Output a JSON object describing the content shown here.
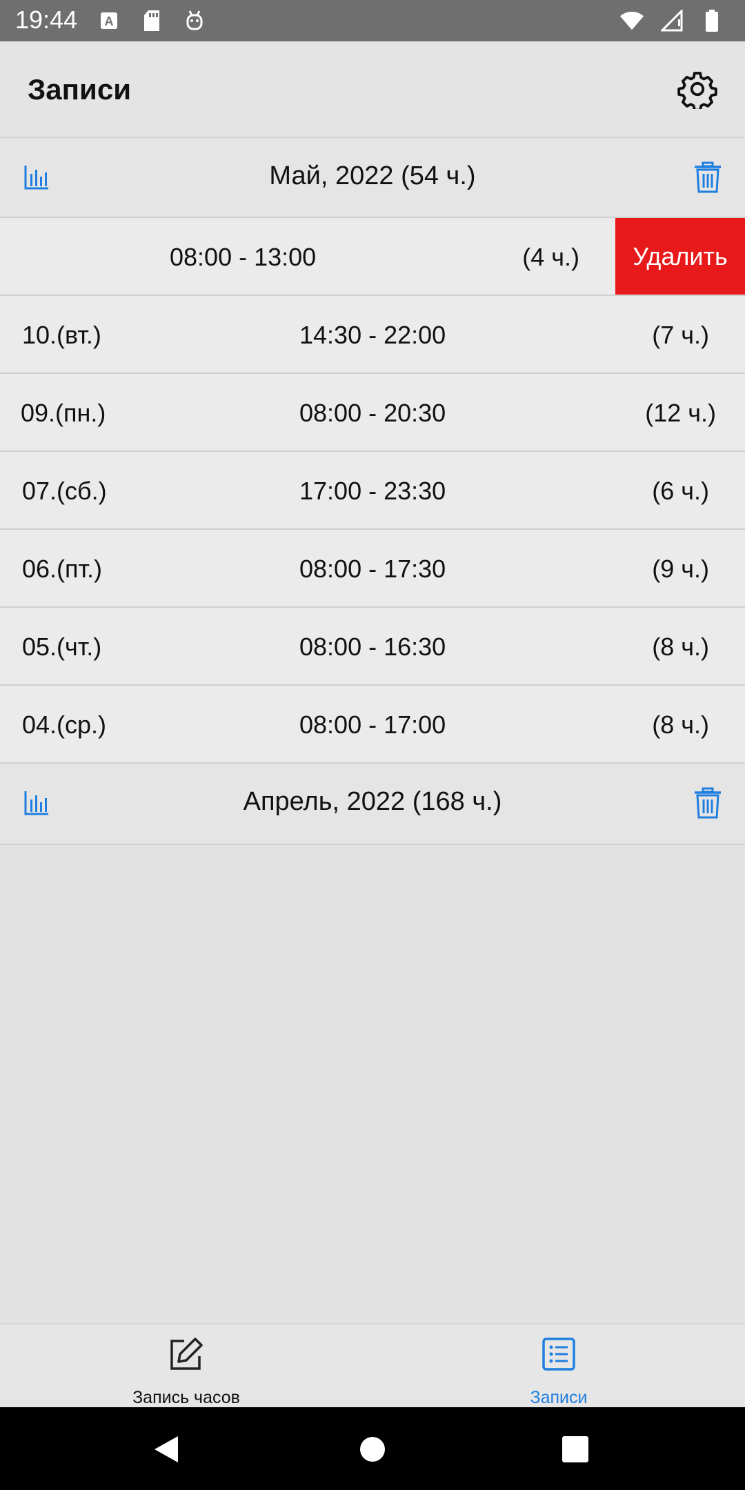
{
  "status_bar": {
    "time": "19:44",
    "left_icons": [
      "text-a-icon",
      "sd-card-icon",
      "android-icon"
    ],
    "right_icons": [
      "wifi-icon",
      "signal-icon",
      "battery-icon"
    ]
  },
  "app_bar": {
    "title": "Записи",
    "settings_icon": "gear-icon"
  },
  "months": [
    {
      "title": "Май, 2022 (54 ч.)",
      "entries": [
        {
          "date": "",
          "time": "08:00 - 13:00",
          "hours": "(4 ч.)",
          "swiped": true,
          "delete_label": "Удалить"
        },
        {
          "date": "10.(вт.)",
          "time": "14:30 - 22:00",
          "hours": "(7 ч.)"
        },
        {
          "date": "09.(пн.)",
          "time": "08:00 - 20:30",
          "hours": "(12 ч.)"
        },
        {
          "date": "07.(сб.)",
          "time": "17:00 - 23:30",
          "hours": "(6 ч.)"
        },
        {
          "date": "06.(пт.)",
          "time": "08:00 - 17:30",
          "hours": "(9 ч.)"
        },
        {
          "date": "05.(чт.)",
          "time": "08:00 - 16:30",
          "hours": "(8 ч.)"
        },
        {
          "date": "04.(ср.)",
          "time": "08:00 - 17:00",
          "hours": "(8 ч.)"
        }
      ]
    },
    {
      "title": "Апрель, 2022 (168 ч.)",
      "entries": []
    }
  ],
  "bottom_nav": {
    "items": [
      {
        "label": "Запись часов",
        "icon": "edit-icon",
        "active": false
      },
      {
        "label": "Записи",
        "icon": "list-icon",
        "active": true
      }
    ]
  },
  "colors": {
    "accent": "#1e7fe0",
    "delete": "#e8191b",
    "background": "#e2e2e2"
  }
}
